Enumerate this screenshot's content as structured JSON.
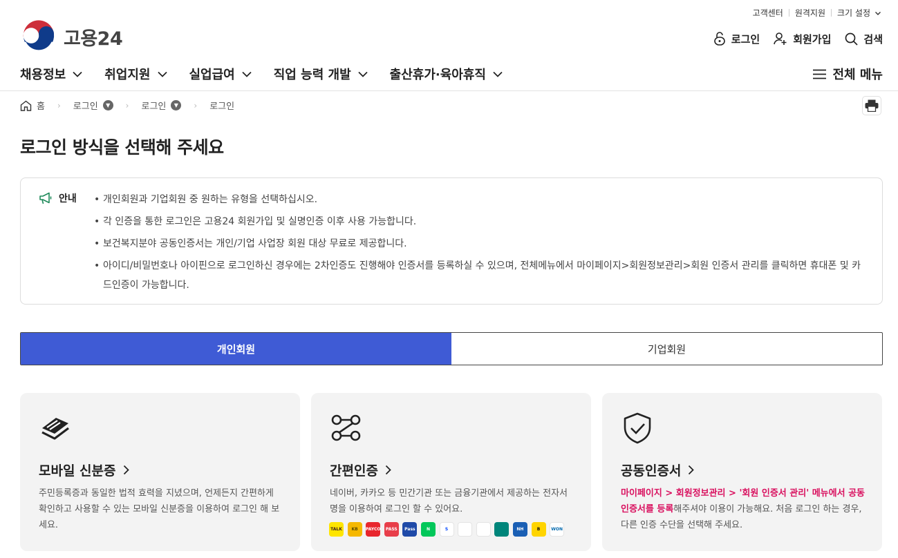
{
  "top_links": [
    "고객센터",
    "원격지원",
    "크기 설정"
  ],
  "logo": {
    "text": "고용24"
  },
  "util": {
    "login": "로그인",
    "signup": "회원가입",
    "search": "검색"
  },
  "gnb": [
    "채용정보",
    "취업지원",
    "실업급여",
    "직업 능력 개발",
    "출산휴가·육아휴직"
  ],
  "all_menu": "전체 메뉴",
  "breadcrumb": {
    "home": "홈",
    "items": [
      "로그인",
      "로그인",
      "로그인"
    ]
  },
  "page_title": "로그인 방식을 선택해 주세요",
  "notice": {
    "label": "안내",
    "items": [
      "개인회원과 기업회원 중 원하는 유형을 선택하십시오.",
      "각 인증을 통한 로그인은 고용24 회원가입 및 실명인증 이후 사용 가능합니다.",
      "보건복지분야 공동인증서는 개인/기업 사업장 회원 대상 무료로 제공합니다.",
      "아이디/비밀번호나 아이핀으로 로그인하신 경우에는 2차인증도 진행해야 인증서를 등록하실 수 있으며, 전체메뉴에서 마이페이지>회원정보관리>회원 인증서 관리를 클릭하면 휴대폰 및 카드인증이 가능합니다."
    ]
  },
  "tabs": {
    "personal": "개인회원",
    "corporate": "기업회원",
    "active": "개인회원"
  },
  "cards": {
    "mobile_id": {
      "title": "모바일 신분증",
      "desc": "주민등록증과 동일한 법적 효력을 지녔으며, 언제든지 간편하게 확인하고 사용할 수 있는 모바일 신분증을 이용하여 로그인 해 보세요."
    },
    "simple_auth": {
      "title": "간편인증",
      "desc": "네이버, 카카오 등 민간기관 또는 금융기관에서 제공하는 전자서명을 이용하여 로그인 할 수 있어요."
    },
    "joint_cert": {
      "title": "공동인증서",
      "desc_highlight": "마이페이지 > 회원정보관리 > '회원 인증서 관리' 메뉴에서 공동인증서를 등록",
      "desc_rest": "해주셔야 이용이 가능해요. 처음 로그인 하는 경우, 다른 인증 수단을 선택해 주세요."
    }
  },
  "auth_providers": [
    {
      "icon": "kakao-icon",
      "text": "TALK",
      "color": "#fee500",
      "fg": "#3c1e1e"
    },
    {
      "icon": "kookmin-icon",
      "text": "KB",
      "color": "#f5b800",
      "fg": "#5a4a00"
    },
    {
      "icon": "payco-icon",
      "text": "PAYCO",
      "color": "#e8262d",
      "fg": "#fff"
    },
    {
      "icon": "pass-icon",
      "text": "PASS",
      "color": "#e83e4a",
      "fg": "#fff"
    },
    {
      "icon": "samsung-pass-icon",
      "text": "Pass",
      "color": "#1f4aa8",
      "fg": "#fff"
    },
    {
      "icon": "naver-icon",
      "text": "N",
      "color": "#03c75a",
      "fg": "#fff"
    },
    {
      "icon": "shinhan-icon",
      "text": "S",
      "color": "#ffffff",
      "fg": "#0046ff"
    },
    {
      "icon": "toss-icon",
      "text": "",
      "color": "#ffffff",
      "fg": "#0064ff"
    },
    {
      "icon": "banksalad-icon",
      "text": "",
      "color": "#ffffff",
      "fg": "#1dbf8a"
    },
    {
      "icon": "hana-icon",
      "text": "",
      "color": "#00857a",
      "fg": "#fff"
    },
    {
      "icon": "nh-icon",
      "text": "NH",
      "color": "#1a5fb4",
      "fg": "#fff"
    },
    {
      "icon": "bank-b-icon",
      "text": "B",
      "color": "#ffd400",
      "fg": "#111"
    },
    {
      "icon": "woori-icon",
      "text": "WON",
      "color": "#ffffff",
      "fg": "#0067ac"
    }
  ]
}
